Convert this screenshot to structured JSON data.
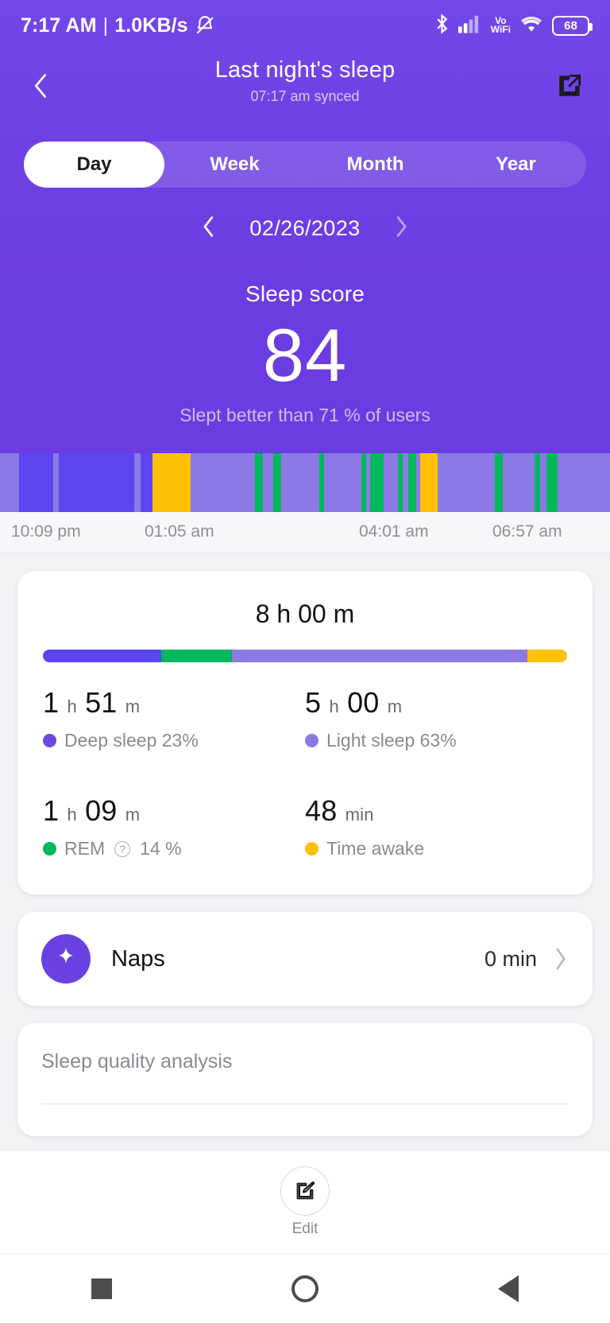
{
  "status_bar": {
    "time": "7:17 AM",
    "separator": "|",
    "network_speed": "1.0KB/s",
    "mute_icon": "bell-mute-icon",
    "bluetooth_icon": "bluetooth-icon",
    "signal_icon": "cellular-signal-icon",
    "volte_label_top": "Vo",
    "volte_label_bottom": "WiFi",
    "wifi_icon": "wifi-icon",
    "battery_level": "68"
  },
  "app_bar": {
    "back_icon": "back-chevron-icon",
    "title": "Last night's sleep",
    "subtitle": "07:17 am synced",
    "share_icon": "share-external-icon"
  },
  "tabs": {
    "items": [
      {
        "label": "Day",
        "active": true
      },
      {
        "label": "Week",
        "active": false
      },
      {
        "label": "Month",
        "active": false
      },
      {
        "label": "Year",
        "active": false
      }
    ]
  },
  "date_nav": {
    "prev_icon": "chevron-left-icon",
    "date": "02/26/2023",
    "next_icon": "chevron-right-icon"
  },
  "score": {
    "label": "Sleep score",
    "value": "84",
    "comparison": "Slept better than 71 % of users"
  },
  "colors": {
    "header_purple": "#6b3ce2",
    "deep_sleep": "#5b46ef",
    "light_sleep": "#8d79e6",
    "rem": "#00b85c",
    "awake": "#ffc107",
    "card_white": "#ffffff",
    "page_background": "#f2f2f5"
  },
  "chart_data": {
    "type": "bar",
    "title": "Sleep stages hypnogram",
    "xlabel": "",
    "ylabel": "",
    "grid": false,
    "legend_position": "below-in-card",
    "x_tick_labels": [
      "10:09 pm",
      "01:05 am",
      "04:01 am",
      "06:57 am"
    ],
    "x_range": [
      "10:09 pm",
      "07:09 am"
    ],
    "stage_colors": {
      "light": "#8d79e6",
      "deep": "#5b46ef",
      "rem": "#00b85c",
      "awake": "#ffc107"
    },
    "segments": [
      {
        "stage": "light",
        "width_pct": 3.1
      },
      {
        "stage": "deep",
        "width_pct": 5.6
      },
      {
        "stage": "light",
        "width_pct": 1.0
      },
      {
        "stage": "deep",
        "width_pct": 12.3
      },
      {
        "stage": "light",
        "width_pct": 1.0
      },
      {
        "stage": "deep",
        "width_pct": 2.0
      },
      {
        "stage": "awake",
        "width_pct": 6.3
      },
      {
        "stage": "light",
        "width_pct": 10.5
      },
      {
        "stage": "rem",
        "width_pct": 1.3
      },
      {
        "stage": "light",
        "width_pct": 1.7
      },
      {
        "stage": "rem",
        "width_pct": 1.3
      },
      {
        "stage": "light",
        "width_pct": 6.2
      },
      {
        "stage": "rem",
        "width_pct": 0.8
      },
      {
        "stage": "light",
        "width_pct": 6.2
      },
      {
        "stage": "rem",
        "width_pct": 0.8
      },
      {
        "stage": "light",
        "width_pct": 0.6
      },
      {
        "stage": "rem",
        "width_pct": 2.2
      },
      {
        "stage": "light",
        "width_pct": 2.3
      },
      {
        "stage": "rem",
        "width_pct": 0.9
      },
      {
        "stage": "light",
        "width_pct": 0.9
      },
      {
        "stage": "rem",
        "width_pct": 1.2
      },
      {
        "stage": "light",
        "width_pct": 0.7
      },
      {
        "stage": "awake",
        "width_pct": 2.9
      },
      {
        "stage": "light",
        "width_pct": 9.4
      },
      {
        "stage": "rem",
        "width_pct": 1.3
      },
      {
        "stage": "light",
        "width_pct": 5.1
      },
      {
        "stage": "rem",
        "width_pct": 1.0
      },
      {
        "stage": "light",
        "width_pct": 1.0
      },
      {
        "stage": "rem",
        "width_pct": 1.9
      },
      {
        "stage": "light",
        "width_pct": 8.5
      }
    ],
    "summary": {
      "total": "8 h 00 m",
      "categories": [
        "Deep sleep",
        "Light sleep",
        "REM",
        "Time awake"
      ],
      "durations": [
        "1 h 51 m",
        "5 h 00 m",
        "1 h 09 m",
        "48 min"
      ],
      "percentages": [
        23,
        63,
        14,
        10
      ]
    }
  },
  "sleep_card": {
    "total_time": "8 h 00 m",
    "bar_segments": [
      {
        "name": "deep",
        "pct": 22.5,
        "color": "#5b46ef"
      },
      {
        "name": "rem",
        "pct": 13.5,
        "color": "#00b85c"
      },
      {
        "name": "light",
        "pct": 56.5,
        "color": "#8d79e6"
      },
      {
        "name": "awake",
        "pct": 7.5,
        "color": "#ffc107"
      }
    ],
    "stats": [
      {
        "value_num": "1",
        "unit_1": "h",
        "value_num2": "51",
        "unit_2": "m",
        "label": "Deep sleep 23%",
        "dot_color": "#6b4ae0",
        "has_help": false
      },
      {
        "value_num": "5",
        "unit_1": "h",
        "value_num2": "00",
        "unit_2": "m",
        "label": "Light sleep 63%",
        "dot_color": "#8d79e6",
        "has_help": false
      },
      {
        "value_num": "1",
        "unit_1": "h",
        "value_num2": "09",
        "unit_2": "m",
        "label_pre": "REM",
        "label_post": "14 %",
        "dot_color": "#00b85c",
        "has_help": true,
        "help_icon": "help-question-icon"
      },
      {
        "value_num": "48",
        "unit_1": "min",
        "value_num2": "",
        "unit_2": "",
        "label": "Time awake",
        "dot_color": "#ffc107",
        "has_help": false
      }
    ]
  },
  "naps_card": {
    "icon": "sparkle-star-icon",
    "label": "Naps",
    "value": "0 min",
    "chevron_icon": "chevron-right-icon"
  },
  "quality_card": {
    "title": "Sleep quality analysis"
  },
  "edit_bar": {
    "icon": "edit-pencil-square-icon",
    "label": "Edit"
  },
  "nav_bar": {
    "recents_icon": "square-recents-icon",
    "home_icon": "circle-home-icon",
    "back_icon": "triangle-back-icon"
  }
}
